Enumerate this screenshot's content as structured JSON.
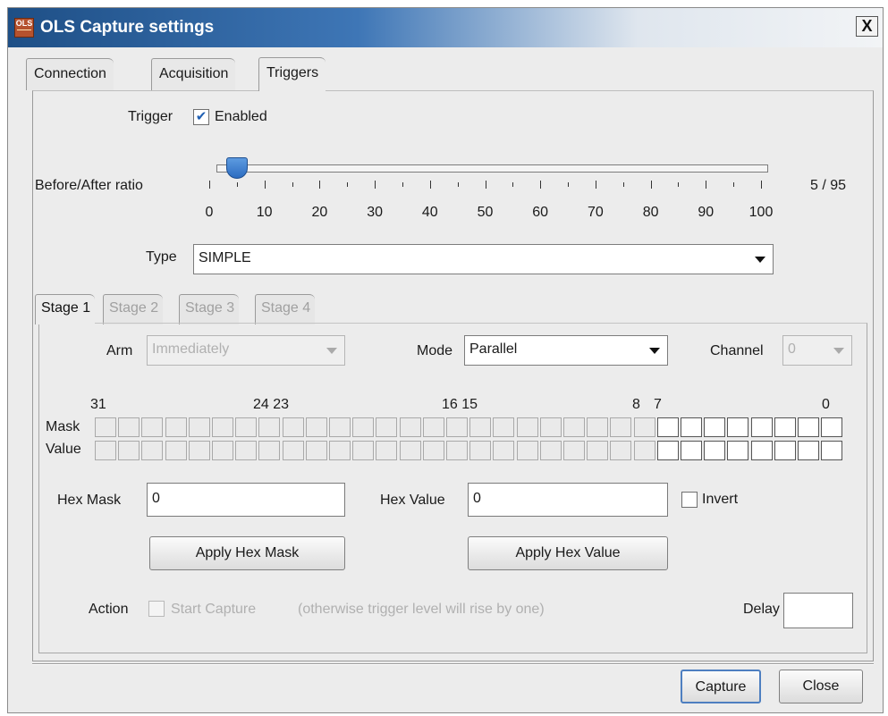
{
  "window": {
    "title": "OLS Capture settings",
    "icon_text": "OLS",
    "close_label": "X"
  },
  "tabs": [
    "Connection",
    "Acquisition",
    "Triggers"
  ],
  "trigger": {
    "label": "Trigger",
    "enabled_label": "Enabled",
    "enabled": true,
    "ratio_label": "Before/After ratio",
    "ratio_value": "5 / 95",
    "ratio_position": 5,
    "tick_labels": [
      "0",
      "10",
      "20",
      "30",
      "40",
      "50",
      "60",
      "70",
      "80",
      "90",
      "100"
    ],
    "type_label": "Type",
    "type_value": "SIMPLE"
  },
  "stage_tabs": [
    "Stage 1",
    "Stage 2",
    "Stage 3",
    "Stage 4"
  ],
  "stage": {
    "arm_label": "Arm",
    "arm_value": "Immediately",
    "mode_label": "Mode",
    "mode_value": "Parallel",
    "channel_label": "Channel",
    "channel_value": "0",
    "bit_labels": {
      "b31": "31",
      "b2423": "24 23",
      "b1615": "16 15",
      "b8": "8",
      "b7": "7",
      "b0": "0"
    },
    "mask_label": "Mask",
    "value_label": "Value",
    "enabled_bits": 8,
    "hex_mask_label": "Hex Mask",
    "hex_mask_value": "0",
    "hex_value_label": "Hex Value",
    "hex_value_value": "0",
    "invert_label": "Invert",
    "apply_mask_label": "Apply Hex Mask",
    "apply_value_label": "Apply Hex Value",
    "action_label": "Action",
    "start_capture_label": "Start Capture",
    "hint": "(otherwise trigger level will rise by one)",
    "delay_label": "Delay",
    "delay_value": ""
  },
  "footer": {
    "capture_label": "Capture",
    "close_label": "Close"
  }
}
